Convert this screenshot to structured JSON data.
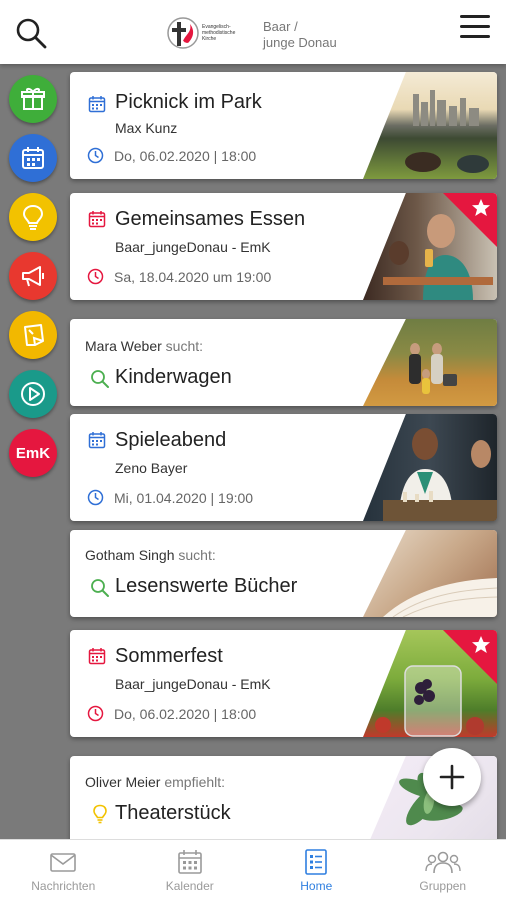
{
  "header": {
    "logo_text": "Evangelisch-methodistische Kirche",
    "location_line1": "Baar /",
    "location_line2": "junge Donau"
  },
  "rail": [
    {
      "name": "gift",
      "color": "#3fae3a"
    },
    {
      "name": "calendar",
      "color": "#2f6fd6"
    },
    {
      "name": "lightbulb",
      "color": "#f2c200"
    },
    {
      "name": "megaphone",
      "color": "#e8382f"
    },
    {
      "name": "sticky-note",
      "color": "#f2b800"
    },
    {
      "name": "play",
      "color": "#1a9a8a"
    },
    {
      "name": "emk",
      "label": "EmK",
      "color": "#e5173f"
    }
  ],
  "cards": [
    {
      "type": "event",
      "title": "Picknick im Park",
      "subtitle": "Max Kunz",
      "date": "Do, 06.02.2020 | 18:00",
      "color": "#2f6fd6",
      "starred": false
    },
    {
      "type": "event",
      "title": "Gemeinsames Essen",
      "subtitle": "Baar_jungeDonau - EmK",
      "date": "Sa, 18.04.2020 um 19:00",
      "color": "#e5173f",
      "starred": true
    },
    {
      "type": "search",
      "user": "Mara Weber",
      "verb": "sucht:",
      "title": "Kinderwagen"
    },
    {
      "type": "event",
      "title": "Spieleabend",
      "subtitle": "Zeno Bayer",
      "date": "Mi, 01.04.2020 | 19:00",
      "color": "#2f6fd6",
      "starred": false
    },
    {
      "type": "search",
      "user": "Gotham Singh",
      "verb": "sucht:",
      "title": "Lesenswerte Bücher"
    },
    {
      "type": "event",
      "title": "Sommerfest",
      "subtitle": "Baar_jungeDonau - EmK",
      "date": "Do, 06.02.2020 | 18:00",
      "color": "#e5173f",
      "starred": true
    },
    {
      "type": "recommend",
      "user": "Oliver Meier",
      "verb": "empfiehlt:",
      "title": "Theaterstück"
    }
  ],
  "nav": [
    {
      "label": "Nachrichten",
      "icon": "envelope-icon",
      "active": false
    },
    {
      "label": "Kalender",
      "icon": "calendar-icon",
      "active": false
    },
    {
      "label": "Home",
      "icon": "list-icon",
      "active": true
    },
    {
      "label": "Gruppen",
      "icon": "group-icon",
      "active": false
    }
  ],
  "colors": {
    "accent": "#2f7fe0",
    "search_green": "#4caf50",
    "recommend_yellow": "#f2c200"
  }
}
